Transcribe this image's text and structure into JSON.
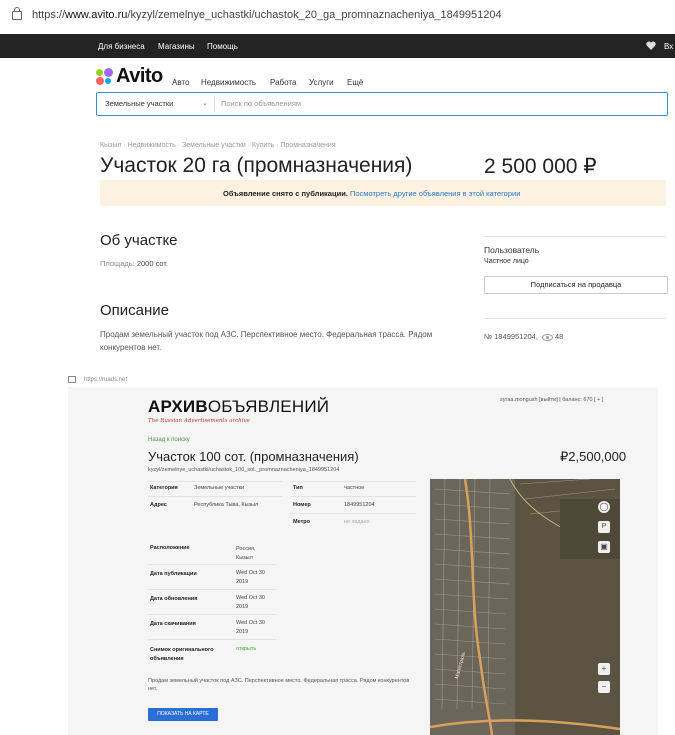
{
  "browser1": {
    "url_prefix": "https://",
    "url_domain": "www.avito.ru",
    "url_path": "/kyzyl/zemelnye_uchastki/uchastok_20_ga_promnaznacheniya_1849951204"
  },
  "topbar": {
    "links": [
      "Для бизнеса",
      "Магазины",
      "Помощь"
    ],
    "login": "Вх"
  },
  "avito": {
    "logo": "Avito",
    "logo_colors": [
      "#97cf26",
      "#a169f7",
      "#ff6163",
      "#00aaff"
    ],
    "nav": [
      "Авто",
      "Недвижимость",
      "Работа",
      "Услуги",
      "Ещё"
    ],
    "search_category": "Земельные участки",
    "search_placeholder": "Поиск по объявлениям",
    "breadcrumbs": "Кызыл · Недвижимость · Земельные участки · Купить · Промназначения",
    "title": "Участок 20 га (промназначения)",
    "price": "2 500 000 ₽",
    "notice_bold": "Объявление снято с публикации.",
    "notice_link": "Посмотреть другие объявления в этой категории",
    "about_heading": "Об участке",
    "area_label": "Площадь:",
    "area_value": "2000 сот.",
    "seller_name": "Пользователь",
    "seller_type": "Частное лицо",
    "subscribe_label": "Подписаться на продавца",
    "description_heading": "Описание",
    "description": "Продам земельный участок под АЗС. Перспективное место. Федеральная трасса. Рядом конкурентов нет.",
    "ad_number": "№ 1849951204,",
    "views": "48"
  },
  "browser2": {
    "url": "https://ruads.net"
  },
  "archive": {
    "logo_bold": "АРХИВ",
    "logo_rest": "ОБЪЯВЛЕНИЙ",
    "tagline": "The Russian Advertisements archive",
    "user_info": "syraa.mongush [выйти] | баланс: 670 [ + ]",
    "back_link": "Назад к поиску",
    "title": "Участок 100 сот. (промназначения)",
    "price": "₽2,500,000",
    "url": "kyzyl/zemelnye_uchastki/uchastok_100_sot._promnaznacheniya_1849951204",
    "rows_left": [
      {
        "key": "Категория",
        "value": "Земельные участки"
      },
      {
        "key": "Адрес",
        "value": "Республика Тыва, Кызыл"
      }
    ],
    "rows_right": [
      {
        "key": "Тип",
        "value": "частное"
      },
      {
        "key": "Номер",
        "value": "1849951204"
      },
      {
        "key": "Метро",
        "value": "не задано"
      }
    ],
    "rows_lower": [
      {
        "key": "Расположение",
        "value1": "Россия,",
        "value2": "Кызыл"
      },
      {
        "key": "Дата публикации",
        "value1": "Wed Oct 30",
        "value2": "2019"
      },
      {
        "key": "Дата обновления",
        "value1": "Wed Oct 30",
        "value2": "2019"
      },
      {
        "key": "Дата скачивания",
        "value1": "Wed Oct 30",
        "value2": "2019"
      }
    ],
    "snapshot_key1": "Снимок оригинального",
    "snapshot_key2": "объявления",
    "snapshot_value": "открыть",
    "description": "Продам земельный участок под АЗС. Перспективное место. Федеральная трасса. Рядом конкурентов нет.",
    "show_map_label": "ПОКАЗАТЬ НА КАРТЕ",
    "map_zoom_in": "+",
    "map_zoom_out": "−",
    "map_road_label": "Магистраль"
  }
}
